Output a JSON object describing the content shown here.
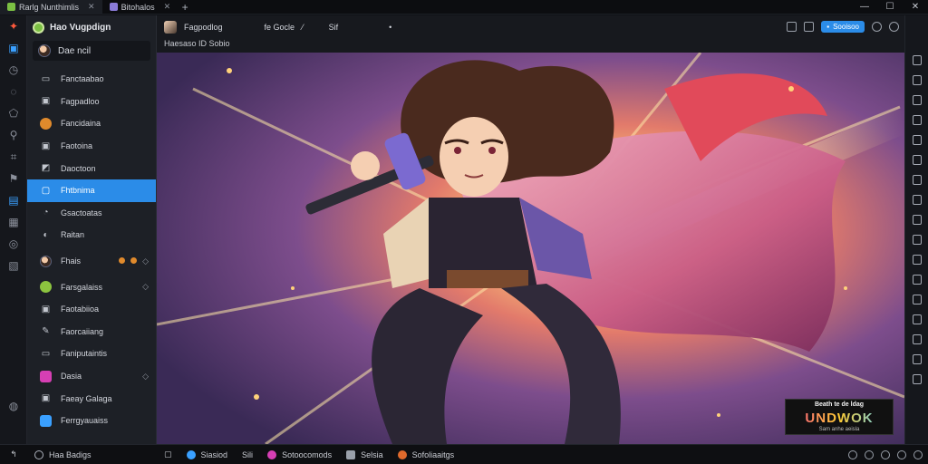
{
  "titlebar": {
    "tabs": [
      {
        "label": "Rarlg Nunthimlis",
        "color": "#7bc043"
      },
      {
        "label": "Bitohalos",
        "color": "#8a7bd8"
      }
    ],
    "new_tab": "+",
    "controls": {
      "minimize": "—",
      "maximize": "☐",
      "close": "✕"
    }
  },
  "rail": {
    "icons": [
      "brand-icon",
      "home-icon",
      "clock-icon",
      "chat-icon",
      "folder-icon",
      "search-icon",
      "tag-icon",
      "flag-icon",
      "layers-icon",
      "grid-icon",
      "circle-icon",
      "image-icon"
    ]
  },
  "sidebar": {
    "title": "Hao Vugpdign",
    "user": "Dae ncil",
    "items": [
      {
        "label": "Fanctaabao",
        "icon": "book"
      },
      {
        "label": "Fagpadloo",
        "icon": "image"
      },
      {
        "label": "Fancidaina",
        "icon": "dot",
        "color": "#e08a2c"
      },
      {
        "label": "Faotoina",
        "icon": "image"
      },
      {
        "label": "Daoctoon",
        "icon": "folder"
      },
      {
        "label": "Fhtbnima",
        "icon": "square",
        "active": true
      },
      {
        "label": "Gsactoatas",
        "icon": "chat"
      },
      {
        "label": "Raitan",
        "icon": "circle"
      },
      {
        "label": "Fhais",
        "icon": "avatar",
        "trail": "◉ ◉  ◇"
      },
      {
        "label": "Farsgalaiss",
        "icon": "dot",
        "color": "#8cc43f",
        "trail": "◇"
      },
      {
        "label": "Faotabiioa",
        "icon": "image"
      },
      {
        "label": "Faorcaiiang",
        "icon": "pencil"
      },
      {
        "label": "Faniputaintis",
        "icon": "square"
      },
      {
        "label": "Dasia",
        "icon": "dot",
        "color": "#d63fb4",
        "trail": "◇"
      },
      {
        "label": "Faeay Galaga",
        "icon": "image"
      },
      {
        "label": "Ferrgyauaiss",
        "icon": "dot",
        "color": "#3aa0ff"
      }
    ]
  },
  "header": {
    "tabs": [
      "Fagpodlog",
      "fe Gocle",
      "⁄",
      "Sif",
      "•"
    ],
    "subtitle": "Haesaso ID Sobio",
    "tools": {
      "pill_label": "Sooisoo"
    }
  },
  "canvas": {
    "watermark_top": "Beath te de ldag",
    "watermark_main": "UNDWOK",
    "watermark_sub": "Sam anhe aeisla"
  },
  "bottom": {
    "left_label": "Haa Badigs",
    "items": [
      {
        "label": "Siasiod",
        "color": "#3aa0ff"
      },
      {
        "label": "Sili",
        "color": "#7bc043"
      },
      {
        "label": "Sotoocomods",
        "color": "#d63fb4"
      },
      {
        "label": "Selsia",
        "color": "#9aa0aa"
      },
      {
        "label": "Sofoliaaitgs",
        "color": "#e06a2c"
      }
    ]
  }
}
